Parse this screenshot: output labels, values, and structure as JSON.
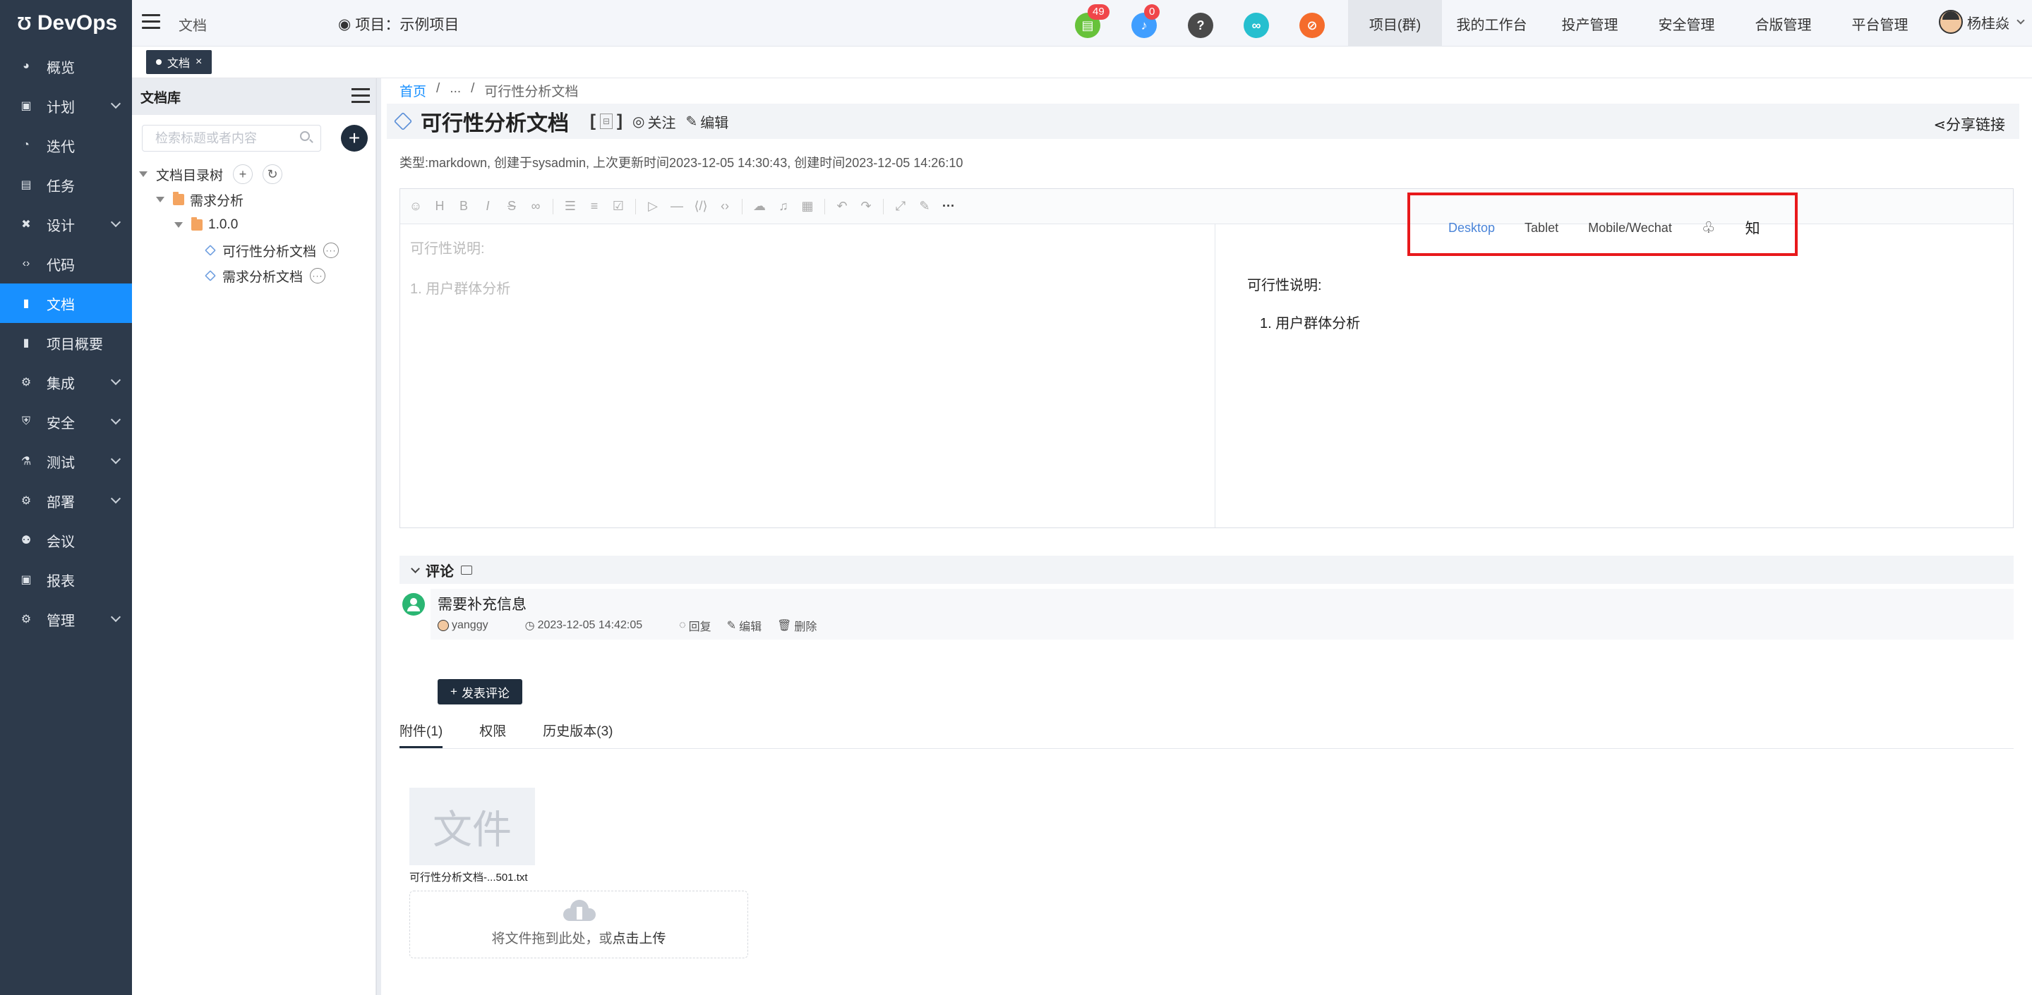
{
  "brand": {
    "name": "DevOps"
  },
  "sidebar": {
    "items": [
      {
        "label": "概览",
        "icon": "dashboard-icon",
        "expandable": false
      },
      {
        "label": "计划",
        "icon": "plan-icon",
        "expandable": true
      },
      {
        "label": "迭代",
        "icon": "iteration-icon",
        "expandable": false
      },
      {
        "label": "任务",
        "icon": "task-icon",
        "expandable": false
      },
      {
        "label": "设计",
        "icon": "design-icon",
        "expandable": true
      },
      {
        "label": "代码",
        "icon": "code-icon",
        "expandable": false
      },
      {
        "label": "文档",
        "icon": "document-icon",
        "expandable": false,
        "active": true
      },
      {
        "label": "项目概要",
        "icon": "summary-icon",
        "expandable": false
      },
      {
        "label": "集成",
        "icon": "integration-icon",
        "expandable": true
      },
      {
        "label": "安全",
        "icon": "shield-icon",
        "expandable": true
      },
      {
        "label": "测试",
        "icon": "flask-icon",
        "expandable": true
      },
      {
        "label": "部署",
        "icon": "deploy-icon",
        "expandable": true
      },
      {
        "label": "会议",
        "icon": "meeting-icon",
        "expandable": false
      },
      {
        "label": "报表",
        "icon": "report-icon",
        "expandable": false
      },
      {
        "label": "管理",
        "icon": "gear-icon",
        "expandable": true
      }
    ]
  },
  "topbar": {
    "page": "文档",
    "project_label": "项目：示例项目",
    "badges": [
      {
        "name": "todo-icon",
        "count": "49",
        "color": "#67c23a"
      },
      {
        "name": "bell-icon",
        "count": "0",
        "color": "#409eff"
      },
      {
        "name": "help-icon",
        "count": "",
        "color": "#4a4a4a"
      },
      {
        "name": "link-icon",
        "count": "",
        "color": "#26bfcf"
      },
      {
        "name": "block-icon",
        "count": "",
        "color": "#f56c2c"
      }
    ],
    "nav": [
      {
        "label": "项目(群)",
        "active": true
      },
      {
        "label": "我的工作台",
        "active": false
      },
      {
        "label": "投产管理",
        "active": false
      },
      {
        "label": "安全管理",
        "active": false
      },
      {
        "label": "合版管理",
        "active": false
      },
      {
        "label": "平台管理",
        "active": false
      }
    ],
    "user": "杨桂焱"
  },
  "tagbar": {
    "tag": "文档",
    "close": "×"
  },
  "library": {
    "title": "文档库",
    "search_placeholder": "检索标题或者内容",
    "tree": {
      "root": "文档目录树",
      "folder": "需求分析",
      "version": "1.0.0",
      "docs": [
        "可行性分析文档",
        "需求分析文档"
      ]
    }
  },
  "breadcrumb": {
    "home": "首页",
    "ellipsis": "...",
    "current": "可行性分析文档",
    "sep": "/"
  },
  "doc": {
    "title": "可行性分析文档",
    "follow": "关注",
    "edit": "编辑",
    "share": "分享链接",
    "meta": "类型:markdown, 创建于sysadmin, 上次更新时间2023-12-05 14:30:43, 创建时间2023-12-05 14:26:10"
  },
  "editor": {
    "left_line1": "可行性说明:",
    "left_line2_num": "1.",
    "left_line2": "用户群体分析",
    "right_line1": "可行性说明:",
    "right_line2": "1. 用户群体分析",
    "preview_tabs": [
      "Desktop",
      "Tablet",
      "Mobile/Wechat"
    ],
    "zhihu": "知"
  },
  "comments": {
    "title": "评论",
    "items": [
      {
        "text": "需要补充信息",
        "author": "yanggy",
        "time": "2023-12-05 14:42:05",
        "reply": "回复",
        "edit": "编辑",
        "delete": "删除"
      }
    ],
    "post_label": "发表评论"
  },
  "tabs": [
    "附件(1)",
    "权限",
    "历史版本(3)"
  ],
  "attachment": {
    "thumb_text": "文件",
    "name": "可行性分析文档-...501.txt",
    "upload_text": "将文件拖到此处，或",
    "upload_link": "点击上传"
  }
}
